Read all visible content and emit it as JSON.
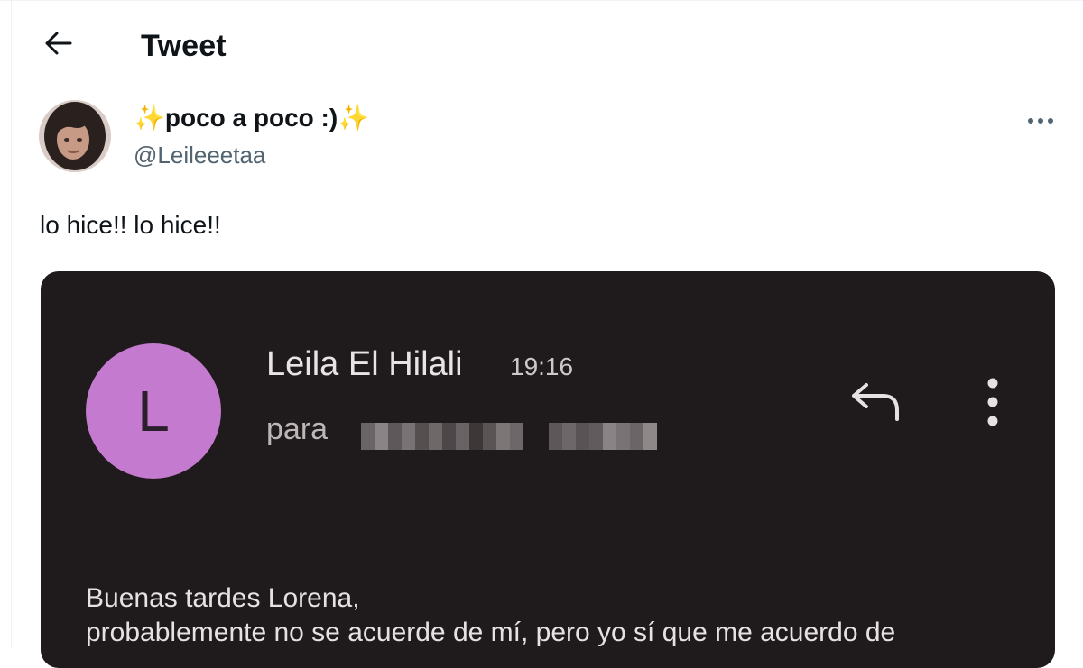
{
  "header": {
    "title": "Tweet",
    "back_icon": "arrow-left-icon"
  },
  "author": {
    "display_name": "poco a poco :)",
    "name_emoji": "✨",
    "handle": "@Leileeetaa"
  },
  "tweet": {
    "text": "lo hice!! lo hice!!"
  },
  "media": {
    "sender_initial": "L",
    "sender_name": "Leila El Hilali",
    "time": "19:16",
    "to_label": "para",
    "body_lines": [
      "Buenas tardes Lorena,",
      "probablemente no se acuerde de mí, pero yo sí que me acuerdo de"
    ],
    "colors": {
      "background": "#1f1a1b",
      "avatar": "#c47ace"
    }
  },
  "icons": {
    "more": "more-horizontal-icon",
    "reply": "reply-arrow-icon",
    "kebab": "more-vertical-icon"
  }
}
